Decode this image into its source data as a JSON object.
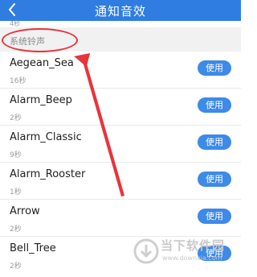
{
  "header": {
    "title": "通知音效",
    "back_icon": "chevron-left-icon"
  },
  "previous_duration_partial": "4秒",
  "section": {
    "label": "系统铃声"
  },
  "ringtones": [
    {
      "name": "Aegean_Sea",
      "duration": "16秒",
      "button": "使用"
    },
    {
      "name": "Alarm_Beep",
      "duration": "2秒",
      "button": "使用"
    },
    {
      "name": "Alarm_Classic",
      "duration": "9秒",
      "button": "使用"
    },
    {
      "name": "Alarm_Rooster",
      "duration": "1秒",
      "button": "使用"
    },
    {
      "name": "Arrow",
      "duration": "2秒",
      "button": "使用"
    },
    {
      "name": "Bell_Tree",
      "duration": "2秒",
      "button": "使用"
    }
  ],
  "watermark": {
    "text": "当下软件园",
    "url": "www.downxia.com"
  },
  "colors": {
    "header": "#2f7de1",
    "button": "#3d8ae8",
    "annotation": "#e8343a"
  }
}
